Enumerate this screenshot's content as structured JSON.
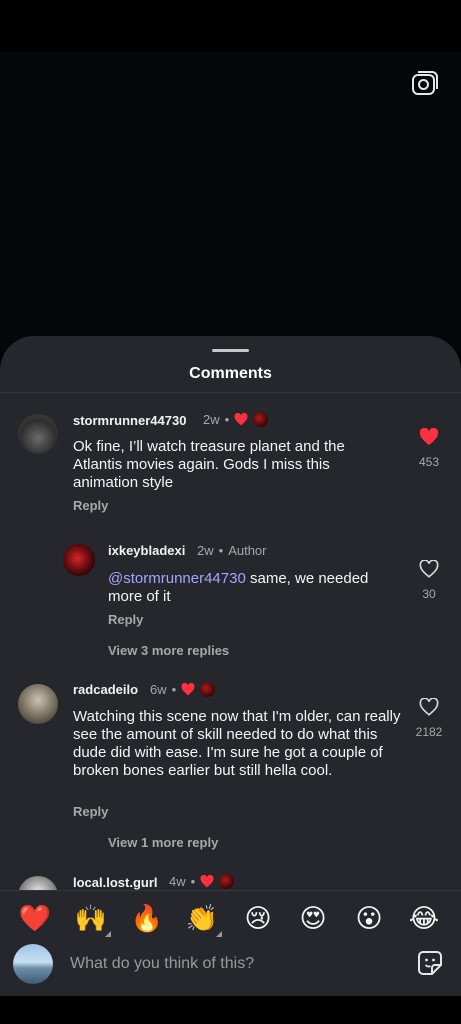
{
  "sheet": {
    "title": "Comments"
  },
  "comments": [
    {
      "username": "stormrunner44730",
      "time": "2w",
      "text": "Ok fine, I’ll watch treasure planet and the Atlantis movies again. Gods I miss this animation style",
      "reply_label": "Reply",
      "likes": "453",
      "liked": true
    },
    {
      "username": "ixkeybladexi",
      "time": "2w",
      "author_label": "Author",
      "mention": "@stormrunner44730",
      "text": " same, we needed more of it",
      "reply_label": "Reply",
      "likes": "30",
      "liked": false,
      "more_replies": "View 3 more replies"
    },
    {
      "username": "radcadeilo",
      "time": "6w",
      "text": "Watching this scene now that I'm older, can really see the amount of skill needed to do what this dude did with ease. I'm sure he got a couple of broken bones earlier but still hella cool.",
      "reply_label": "Reply",
      "likes": "2182",
      "liked": false,
      "more_replies": "View 1 more reply"
    },
    {
      "username": "local.lost.gurl",
      "time": "4w"
    }
  ],
  "emoji_bar": {
    "emojis": [
      "❤️",
      "🙌",
      "🔥",
      "👏",
      "😢",
      "😍",
      "😮",
      "😂"
    ]
  },
  "composer": {
    "placeholder": "What do you think of this?"
  },
  "colors": {
    "sheet_bg": "#25272c",
    "like_red": "#ff3040",
    "mention": "#a4a6ff"
  }
}
